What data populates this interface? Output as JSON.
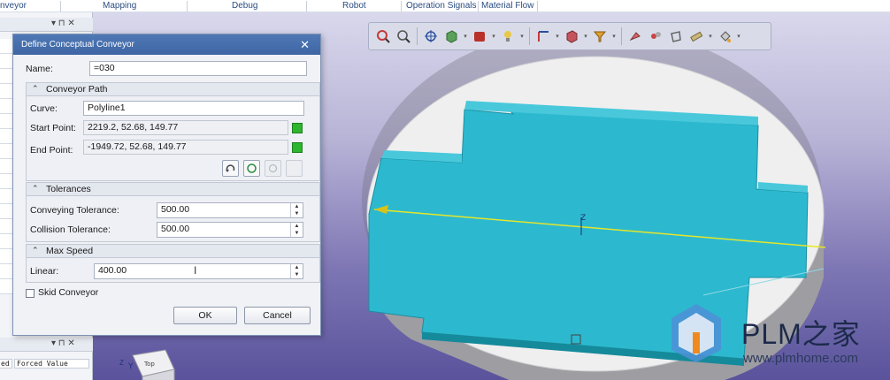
{
  "menubar": {
    "items": [
      "nveyor",
      "Mapping",
      "Debug",
      "Robot",
      "Operation Signals",
      "Material Flow"
    ]
  },
  "left_panel": {
    "top_controls": "▾ ⊓ ✕",
    "bottom_controls": "▾ ⊓ ✕",
    "col_headers": [
      "ed",
      "Forced Value"
    ]
  },
  "dialog": {
    "title": "Define Conceptual Conveyor",
    "close_glyph": "✕",
    "name_label": "Name:",
    "name_value": "=030",
    "conveyor_path": {
      "header": "Conveyor Path",
      "curve_label": "Curve:",
      "curve_value": "Polyline1",
      "start_label": "Start Point:",
      "start_value": "2219.2, 52.68, 149.77",
      "end_label": "End Point:",
      "end_value": "-1949.72, 52.68, 149.77"
    },
    "tolerances": {
      "header": "Tolerances",
      "conveying_label": "Conveying Tolerance:",
      "conveying_value": "500.00",
      "collision_label": "Collision Tolerance:",
      "collision_value": "500.00"
    },
    "max_speed": {
      "header": "Max Speed",
      "linear_label": "Linear:",
      "linear_value": "400.00"
    },
    "skid_label": "Skid Conveyor",
    "skid_checked": false,
    "ok_label": "OK",
    "cancel_label": "Cancel"
  },
  "viewport": {
    "axis_z": "Z",
    "axis_y": "Y",
    "cube_label": "Top"
  },
  "watermark": {
    "brand": "PLM之家",
    "url": "www.plmhome.com"
  },
  "colors": {
    "conveyor": "#2cb9cf",
    "path_line": "#e6e62a",
    "accent_green": "#2db52d"
  }
}
